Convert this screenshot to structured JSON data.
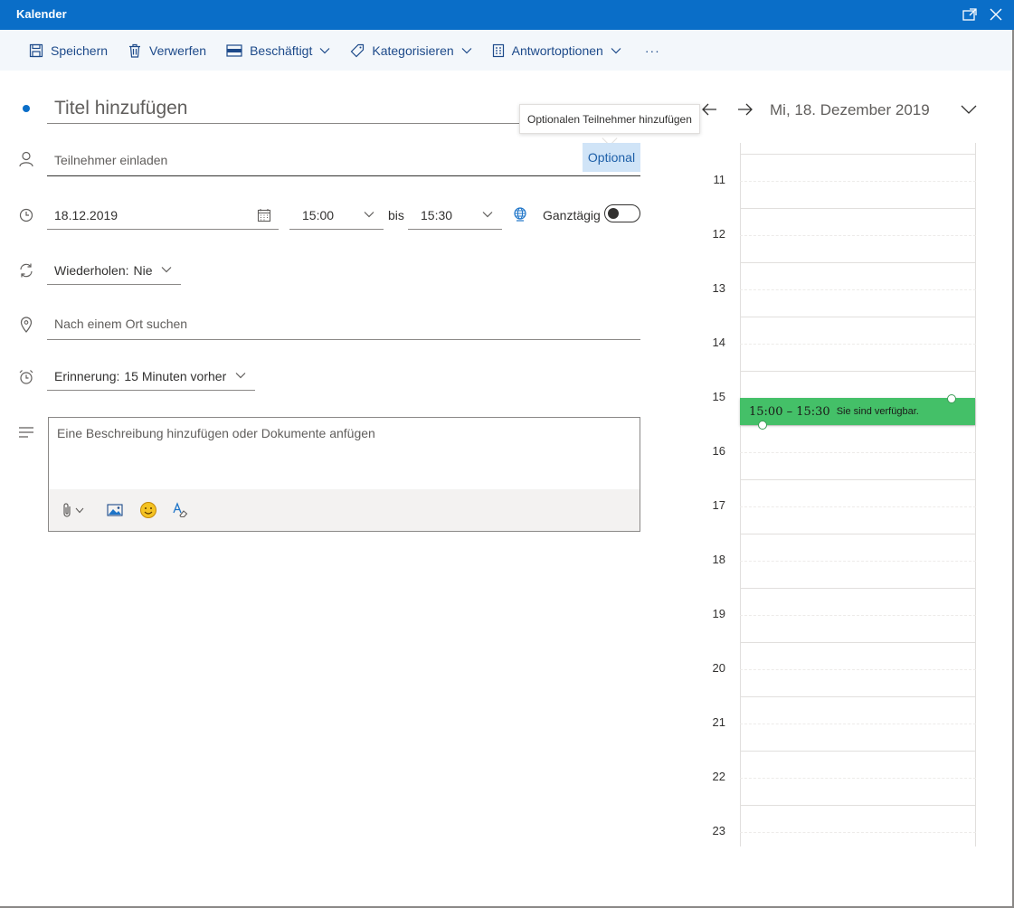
{
  "window": {
    "title": "Kalender"
  },
  "toolbar": {
    "save": "Speichern",
    "discard": "Verwerfen",
    "busy": "Beschäftigt",
    "categorize": "Kategorisieren",
    "response": "Antwortoptionen",
    "more": "···"
  },
  "form": {
    "title_placeholder": "Titel hinzufügen",
    "tooltip": "Optionalen Teilnehmer hinzufügen",
    "attendees_placeholder": "Teilnehmer einladen",
    "optional_label": "Optional",
    "date": "18.12.2019",
    "start_time": "15:00",
    "to_label": "bis",
    "end_time": "15:30",
    "all_day_label": "Ganztägig",
    "all_day": false,
    "repeat_label": "Wiederholen:",
    "repeat_value": "Nie",
    "location_placeholder": "Nach einem Ort suchen",
    "reminder_label": "Erinnerung:",
    "reminder_value": "15 Minuten vorher",
    "description_placeholder": "Eine Beschreibung hinzufügen oder Dokumente anfügen"
  },
  "calendar": {
    "date_label": "Mi, 18. Dezember 2019",
    "hours": [
      "11",
      "12",
      "13",
      "14",
      "15",
      "16",
      "17",
      "18",
      "19",
      "20",
      "21",
      "22",
      "23"
    ],
    "event": {
      "time": "15:00 – 15:30",
      "status": "Sie sind verfügbar.",
      "color": "#44c068"
    }
  },
  "colors": {
    "accent": "#0a6ec8",
    "toolbar_bg": "#f3f7fb",
    "optional_bg": "#d0e4f7"
  }
}
